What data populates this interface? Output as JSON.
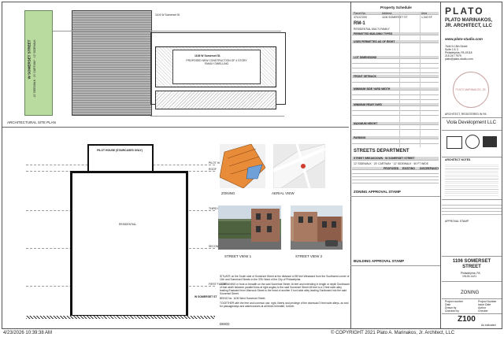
{
  "drawing": {
    "site_plan_label": "ARCHITECTURAL SITE PLAN",
    "street_vertical": "W SOMERSET STREET",
    "sidewalk_vertical": "12' SIDEWALK · 20' CARTWAY · 12' SIDEWALK",
    "lot_top_label": "1104 W Somerset St",
    "lot_mid_label": "1106 W Somerset St.",
    "lot_bottom_label": "1108 W Somerset St.",
    "building_label": "PROPOSED NEW CONSTRUCTION OF 4 STORY FAMILY DWELLING",
    "section_labels": [
      "PILOT HOUSE",
      "ROOF",
      "THIRD FLOOR",
      "SECOND FLOOR",
      "FIRST FLOOR"
    ],
    "pilot_house_label": "PILOT HOUSE (STAIRCASES ONLY)",
    "residential_label": "RESIDENTIAL",
    "section_street_label": "W SOMERSET ST",
    "legal_text_1": "SITUATE on the South side of Somerset Street at the distance of 89 feet Westward from the Southwest corner of 11th and Somerset Streets in the 37th Ward of the City of Philadelphia.",
    "legal_text_2": "CONTAINING in front or breadth on the said Somerset Street 16 feet and extending in length or depth Southward of that width between parallel lines at right angles to the said Somerset Street 65 feet to a 3 feet wide alley leading Eastward from Warnock Street to the head of another 3 foot wide alley leading Southward into the said Somerset Street.",
    "legal_text_3": "BEING No. 1106 West Somerset Street.",
    "legal_text_4": "TOGETHER with the free and common use, right, liberty and privilege of the aforesaid 3 feet wide alleys, as and for passageways and watercourses at all times hereafter, forever.",
    "deed_label": "DEED",
    "zoning_label": "ZONING",
    "aerial_label": "AERIAL VIEW",
    "street1_label": "STREET VIEW 1",
    "street2_label": "STREET VIEW 2",
    "building_stamp_label": "BUILDING APPROVAL STAMP",
    "zoning_stamp_label": "ZONING APPROVAL STAMP"
  },
  "property_schedule": {
    "title": "Property Schedule",
    "columns": [
      "Parcel No.",
      "Address",
      "Area"
    ],
    "parcel": "371017000",
    "address": "1106 SOMERSET ST",
    "area": "1,040 SF",
    "zoning_code": "RM-1",
    "zoning_desc": "RESIDENTIAL MULTI-FAMILY",
    "sections": [
      "PERMITTED BUILDING TYPES",
      "USES PERMITTED AS OF RIGHT",
      "LOT DIMENSIONS",
      "FRONT SETBACK",
      "MINIMUM SIDE YARD WIDTH",
      "MINIMUM REAR YARD",
      "MAXIMUM HEIGHT",
      "PARKING"
    ],
    "street_dept_title": "STREETS DEPARTMENT",
    "street_breakdown": "STREET BREAKDOWN · W SOMERSET STREET",
    "street_dims": "12' SIDEWALK · 20' CARTWAY · 12' SIDEWALK · 50 FT WIDE",
    "street_cols": [
      "PROPOSED",
      "EXISTING",
      "DISCREPANCY"
    ]
  },
  "titleblock": {
    "firm_logo": "PLATO",
    "firm_name": "PLATO MARINAKOS, JR. ARCHITECT, LLC",
    "website": "www.plato-studio.com",
    "address_lines": [
      "7646 N 15th Street",
      "Suite 2 & 3",
      "Philadelphia, PA 19118",
      "215.247.7979",
      "plato@plato-studio.com"
    ],
    "stamp_text": "PLATO MARINAKOS, JR.",
    "cert_text": "ARCHITECT, REGISTERED IN PA",
    "client": "Viola Development LLC",
    "note_heading": "ARCHITECT NOTES",
    "approval_stamp": "APPROVAL STAMP",
    "project_address": "1106 SOMERSET STREET",
    "project_city": "Philadelphia, PA",
    "project_zip": "19133-1421",
    "sheet_title": "ZONING",
    "meta_rows": [
      [
        "Project number",
        "Project Number"
      ],
      [
        "Date",
        "Issue Date"
      ],
      [
        "Drawn by",
        "Author"
      ],
      [
        "Checked by",
        "Checker"
      ]
    ],
    "sheet_number": "Z100",
    "scale": "As indicated"
  },
  "footer": {
    "timestamp": "4/23/2026 10:39:38 AM",
    "copyright": "© COPYRIGHT 2021  Plato A. Marinakos, Jr. Architect, LLC"
  },
  "colors": {
    "orange_lot": "#e98c3a",
    "green_strip": "#b9dba0",
    "hatch_gray": "#9a9a9a"
  }
}
